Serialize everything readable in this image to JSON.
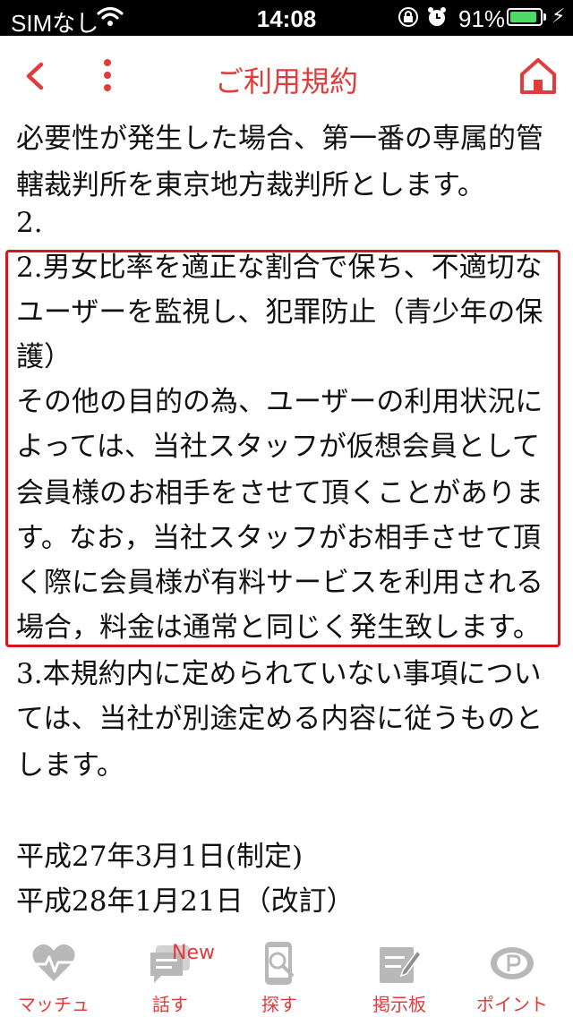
{
  "status_bar": {
    "carrier": "SIMなし",
    "time": "14:08",
    "battery_percent": "91%",
    "battery_level": 0.91,
    "accent_color": "#4cd964"
  },
  "nav": {
    "title": "ご利用規約",
    "back_icon": "chevron-left-icon",
    "more_icon": "more-vertical-icon",
    "home_icon": "home-icon",
    "accent_color": "#e23b3b"
  },
  "content": {
    "lines": [
      "必要性が発生した場合、第一番の専属的管",
      "轄裁判所を東京地方裁判所とします。",
      "2.",
      "2.男女比率を適正な割合で保ち、不適切な",
      "ユーザーを監視し、犯罪防止（青少年の保",
      "護）",
      "その他の目的の為、ユーザーの利用状況に",
      "よっては、当社スタッフが仮想会員として",
      "会員様のお相手をさせて頂くことがありま",
      "す。なお，当社スタッフがお相手させて頂",
      "く際に会員様が有料サービスを利用される",
      "場合，料金は通常と同じく発生致します。",
      "3.本規約内に定められていない事項につい",
      "ては、当社が別途定める内容に従うものと",
      "します。",
      "",
      "平成27年3月1日(制定)",
      "平成28年1月21日（改訂）"
    ],
    "highlight_color": "#d6161b"
  },
  "tabbar": {
    "inactive_icon_color": "#b8b8b8",
    "label_color": "#e23b3b",
    "new_badge": "New",
    "tabs": [
      {
        "label": "マッチュ",
        "icon": "heart-pulse-icon"
      },
      {
        "label": "話す",
        "icon": "chat-icon"
      },
      {
        "label": "探す",
        "icon": "phone-search-icon"
      },
      {
        "label": "掲示板",
        "icon": "board-pen-icon"
      },
      {
        "label": "ポイント",
        "icon": "point-coin-icon"
      }
    ]
  }
}
